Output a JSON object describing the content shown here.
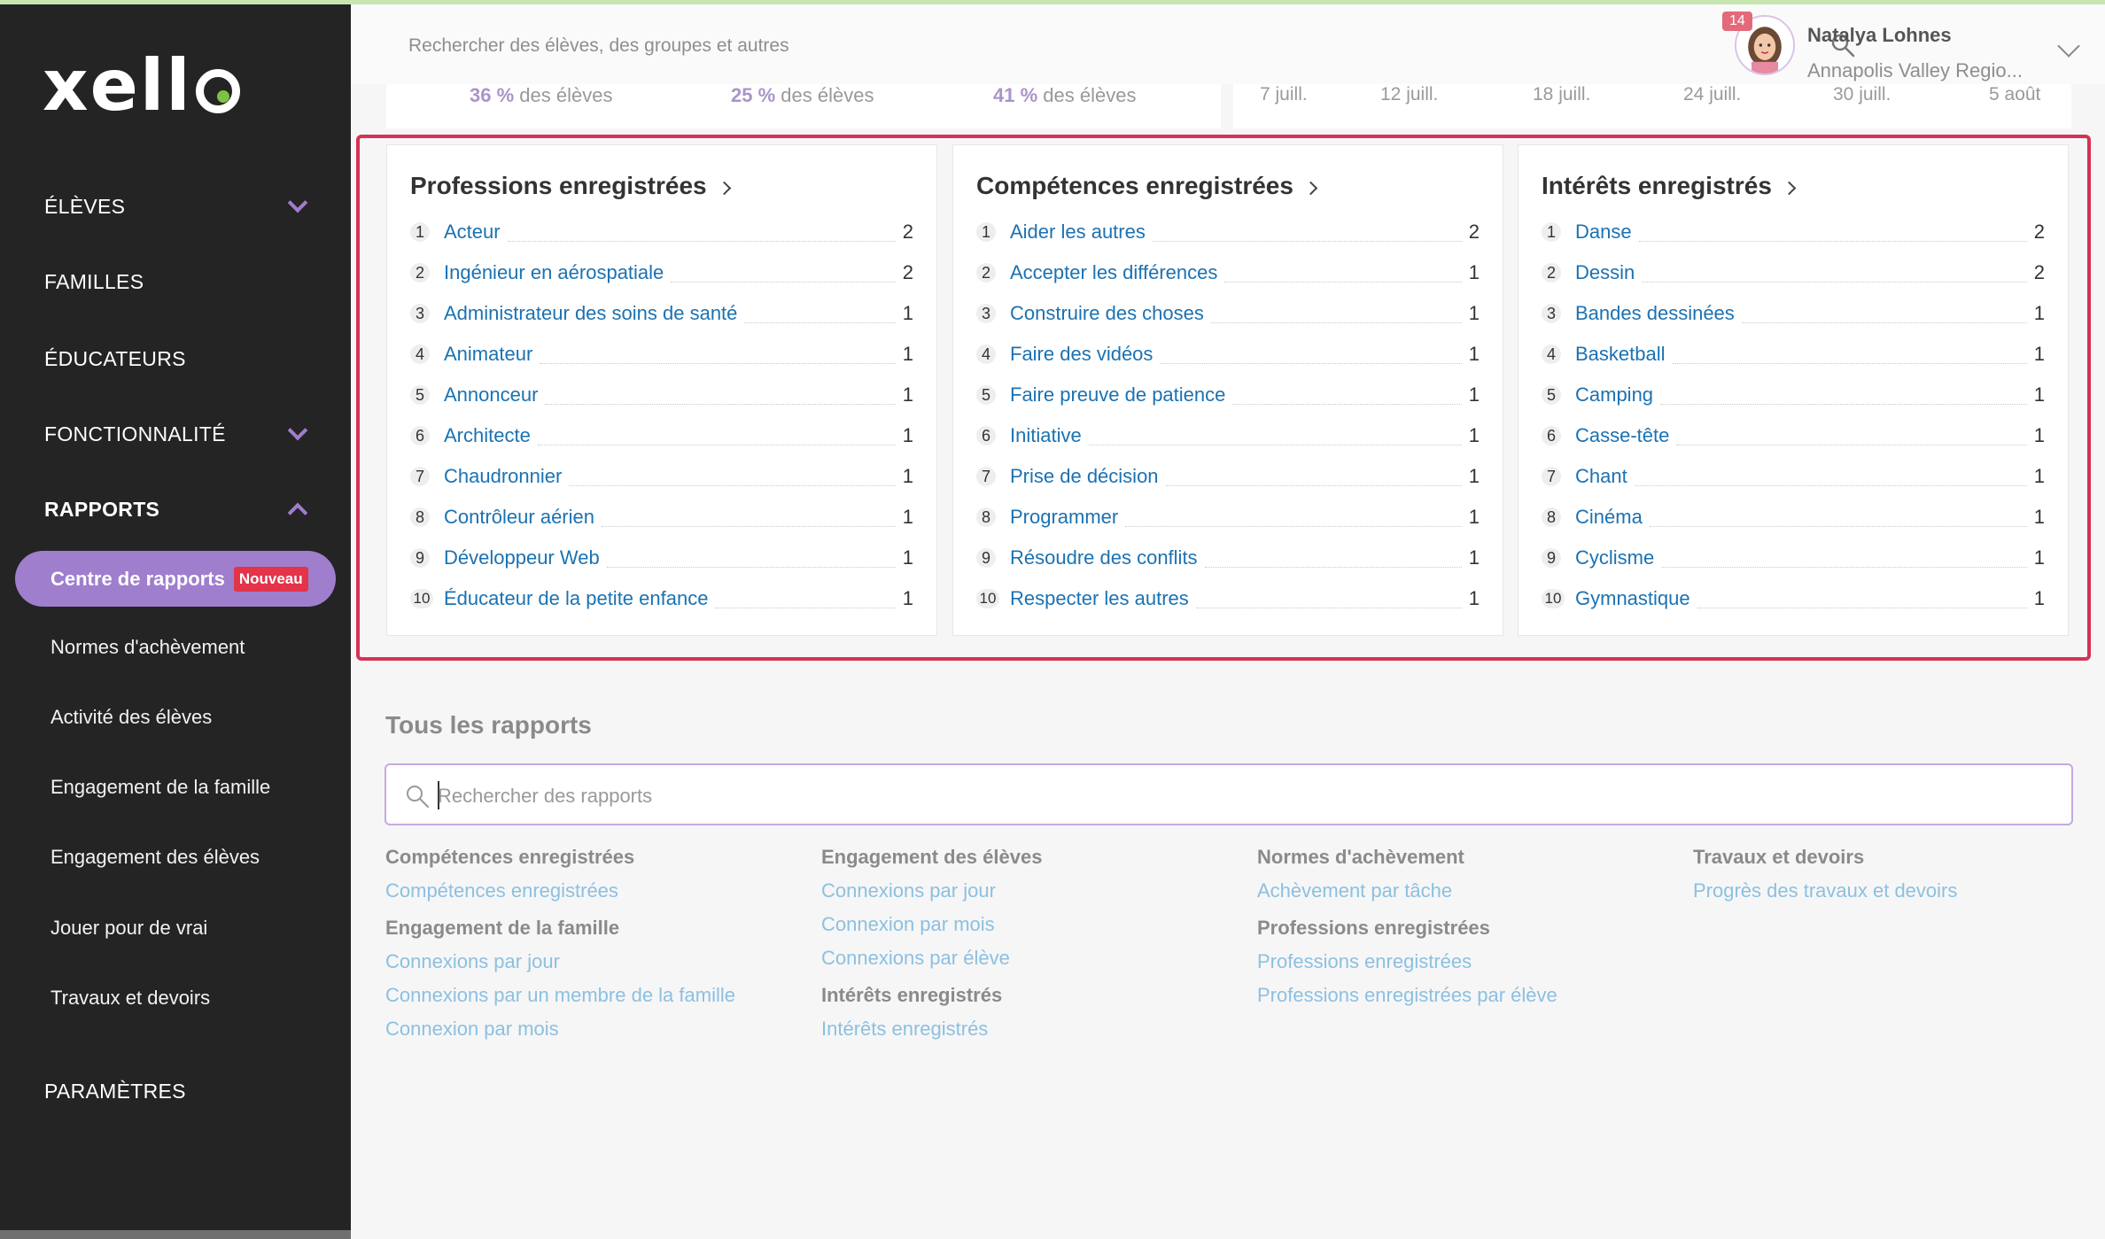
{
  "sidebar": {
    "logo": "xell",
    "items": [
      {
        "label": "ÉLÈVES",
        "has_chevron": true
      },
      {
        "label": "FAMILLES",
        "has_chevron": false
      },
      {
        "label": "ÉDUCATEURS",
        "has_chevron": false
      },
      {
        "label": "FONCTIONNALITÉ",
        "has_chevron": true
      },
      {
        "label": "RAPPORTS",
        "has_chevron": true,
        "expanded": true
      },
      {
        "label": "PARAMÈTRES",
        "has_chevron": false
      }
    ],
    "active_sub": {
      "label": "Centre de rapports",
      "badge": "Nouveau"
    },
    "sub_items": [
      "Normes d'achèvement",
      "Activité des élèves",
      "Engagement de la famille",
      "Engagement des élèves",
      "Jouer pour de vrai",
      "Travaux et devoirs"
    ]
  },
  "header": {
    "search_placeholder": "Rechercher des élèves, des groupes et autres",
    "notifications": "14",
    "user_name": "Natalya Lohnes",
    "user_org": "Annapolis Valley Regio..."
  },
  "stats": {
    "pct": [
      "36 %",
      "25 %",
      "41 %"
    ],
    "suffix": " des élèves",
    "dates": [
      "7 juill.",
      "12 juill.",
      "18 juill.",
      "24 juill.",
      "30 juill.",
      "5 août"
    ]
  },
  "cards": [
    {
      "title": "Professions enregistrées",
      "rows": [
        {
          "rank": "1",
          "label": "Acteur",
          "count": "2"
        },
        {
          "rank": "2",
          "label": "Ingénieur en aérospatiale",
          "count": "2"
        },
        {
          "rank": "3",
          "label": "Administrateur des soins de santé",
          "count": "1"
        },
        {
          "rank": "4",
          "label": "Animateur",
          "count": "1"
        },
        {
          "rank": "5",
          "label": "Annonceur",
          "count": "1"
        },
        {
          "rank": "6",
          "label": "Architecte",
          "count": "1"
        },
        {
          "rank": "7",
          "label": "Chaudronnier",
          "count": "1"
        },
        {
          "rank": "8",
          "label": "Contrôleur aérien",
          "count": "1"
        },
        {
          "rank": "9",
          "label": "Développeur Web",
          "count": "1"
        },
        {
          "rank": "10",
          "label": "Éducateur de la petite enfance",
          "count": "1"
        }
      ]
    },
    {
      "title": "Compétences enregistrées",
      "rows": [
        {
          "rank": "1",
          "label": "Aider les autres",
          "count": "2"
        },
        {
          "rank": "2",
          "label": "Accepter les différences",
          "count": "1"
        },
        {
          "rank": "3",
          "label": "Construire des choses",
          "count": "1"
        },
        {
          "rank": "4",
          "label": "Faire des vidéos",
          "count": "1"
        },
        {
          "rank": "5",
          "label": "Faire preuve de patience",
          "count": "1"
        },
        {
          "rank": "6",
          "label": "Initiative",
          "count": "1"
        },
        {
          "rank": "7",
          "label": "Prise de décision",
          "count": "1"
        },
        {
          "rank": "8",
          "label": "Programmer",
          "count": "1"
        },
        {
          "rank": "9",
          "label": "Résoudre des conflits",
          "count": "1"
        },
        {
          "rank": "10",
          "label": "Respecter les autres",
          "count": "1"
        }
      ]
    },
    {
      "title": "Intérêts enregistrés",
      "rows": [
        {
          "rank": "1",
          "label": "Danse",
          "count": "2"
        },
        {
          "rank": "2",
          "label": "Dessin",
          "count": "2"
        },
        {
          "rank": "3",
          "label": "Bandes dessinées",
          "count": "1"
        },
        {
          "rank": "4",
          "label": "Basketball",
          "count": "1"
        },
        {
          "rank": "5",
          "label": "Camping",
          "count": "1"
        },
        {
          "rank": "6",
          "label": "Casse-tête",
          "count": "1"
        },
        {
          "rank": "7",
          "label": "Chant",
          "count": "1"
        },
        {
          "rank": "8",
          "label": "Cinéma",
          "count": "1"
        },
        {
          "rank": "9",
          "label": "Cyclisme",
          "count": "1"
        },
        {
          "rank": "10",
          "label": "Gymnastique",
          "count": "1"
        }
      ]
    }
  ],
  "all_reports": {
    "title": "Tous les rapports",
    "search_placeholder": "Rechercher des rapports",
    "columns": [
      [
        {
          "heading": "Compétences enregistrées",
          "links": [
            "Compétences enregistrées"
          ]
        },
        {
          "heading": "Engagement de la famille",
          "links": [
            "Connexions par jour",
            "Connexions par un membre de la famille",
            "Connexion par mois"
          ]
        }
      ],
      [
        {
          "heading": "Engagement des élèves",
          "links": [
            "Connexions par jour",
            "Connexion par mois",
            "Connexions par élève"
          ]
        },
        {
          "heading": "Intérêts enregistrés",
          "links": [
            "Intérêts enregistrés"
          ]
        }
      ],
      [
        {
          "heading": "Normes d'achèvement",
          "links": [
            "Achèvement par tâche"
          ]
        },
        {
          "heading": "Professions enregistrées",
          "links": [
            "Professions enregistrées",
            "Professions enregistrées par élève"
          ]
        }
      ],
      [
        {
          "heading": "Travaux et devoirs",
          "links": [
            "Progrès des travaux et devoirs"
          ]
        }
      ]
    ]
  },
  "colors": {
    "sidebar_bg": "#242424",
    "accent_purple": "#9f7ecd",
    "highlight_red": "#d43355",
    "link_blue": "#1b72b2",
    "badge_red": "#e3344a"
  }
}
